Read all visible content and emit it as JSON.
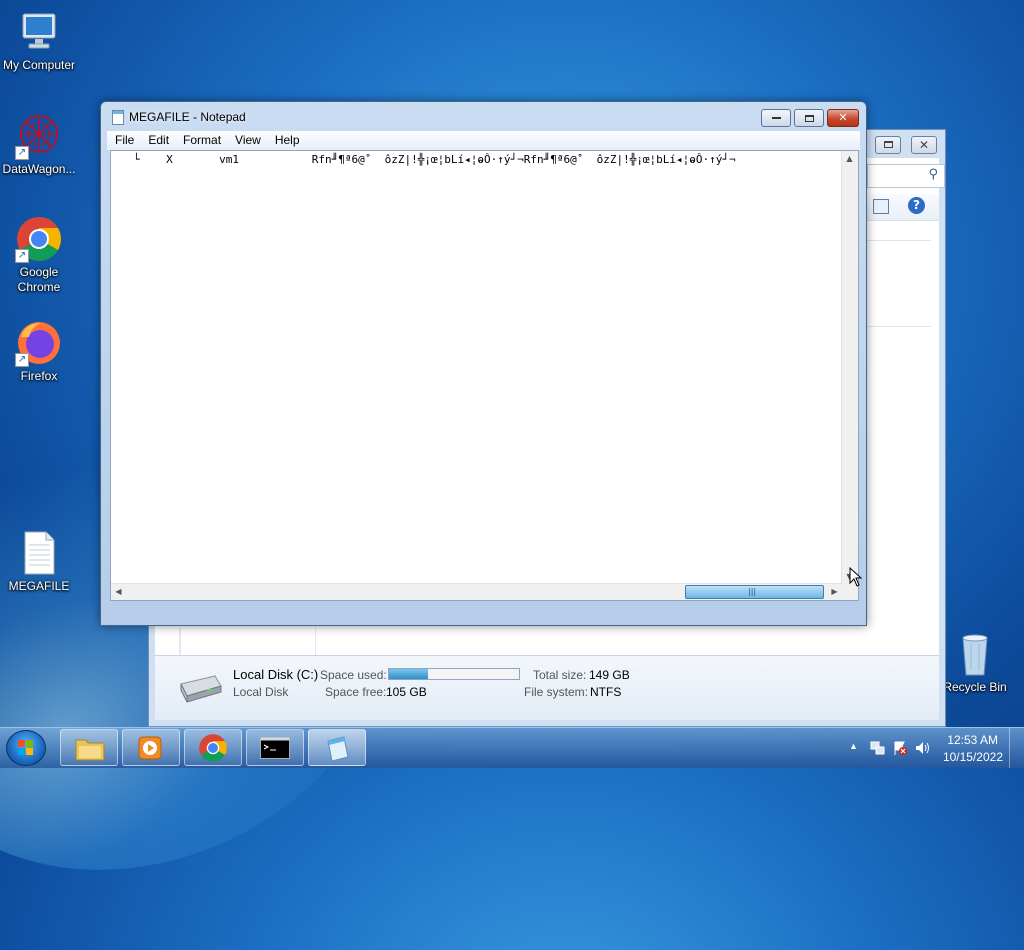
{
  "desktop": {
    "icons": [
      {
        "label": "My Computer"
      },
      {
        "label": "DataWagon..."
      },
      {
        "label": "Google Chrome"
      },
      {
        "label": "Firefox"
      },
      {
        "label": "MEGAFILE"
      },
      {
        "label": "Recycle Bin"
      }
    ]
  },
  "explorer": {
    "drive_name": "Local Disk (C:)",
    "drive_type": "Local Disk",
    "space_used_label": "Space used:",
    "space_used_fraction": 0.3,
    "space_free_label": "Space free:",
    "space_free_value": "105 GB",
    "total_size_label": "Total size:",
    "total_size_value": "149 GB",
    "file_system_label": "File system:",
    "file_system_value": "NTFS"
  },
  "notepad": {
    "title": "MEGAFILE - Notepad",
    "menu": [
      "File",
      "Edit",
      "Format",
      "View",
      "Help"
    ],
    "content": "└    X       vm1           Rfn╜¶ª6@˚  ôzZ|!╬¡œ¦bLí◂¦ⱺÔ·↑ý┘¬Rfn╜¶ª6@˚  ôzZ|!╬¡œ¦bLí◂¦ⱺÔ·↑ý┘¬"
  },
  "taskbar": {
    "time": "12:53 AM",
    "date": "10/15/2022"
  },
  "colors": {
    "accent": "#1c6fc4",
    "progress": "#4aa7d8"
  }
}
